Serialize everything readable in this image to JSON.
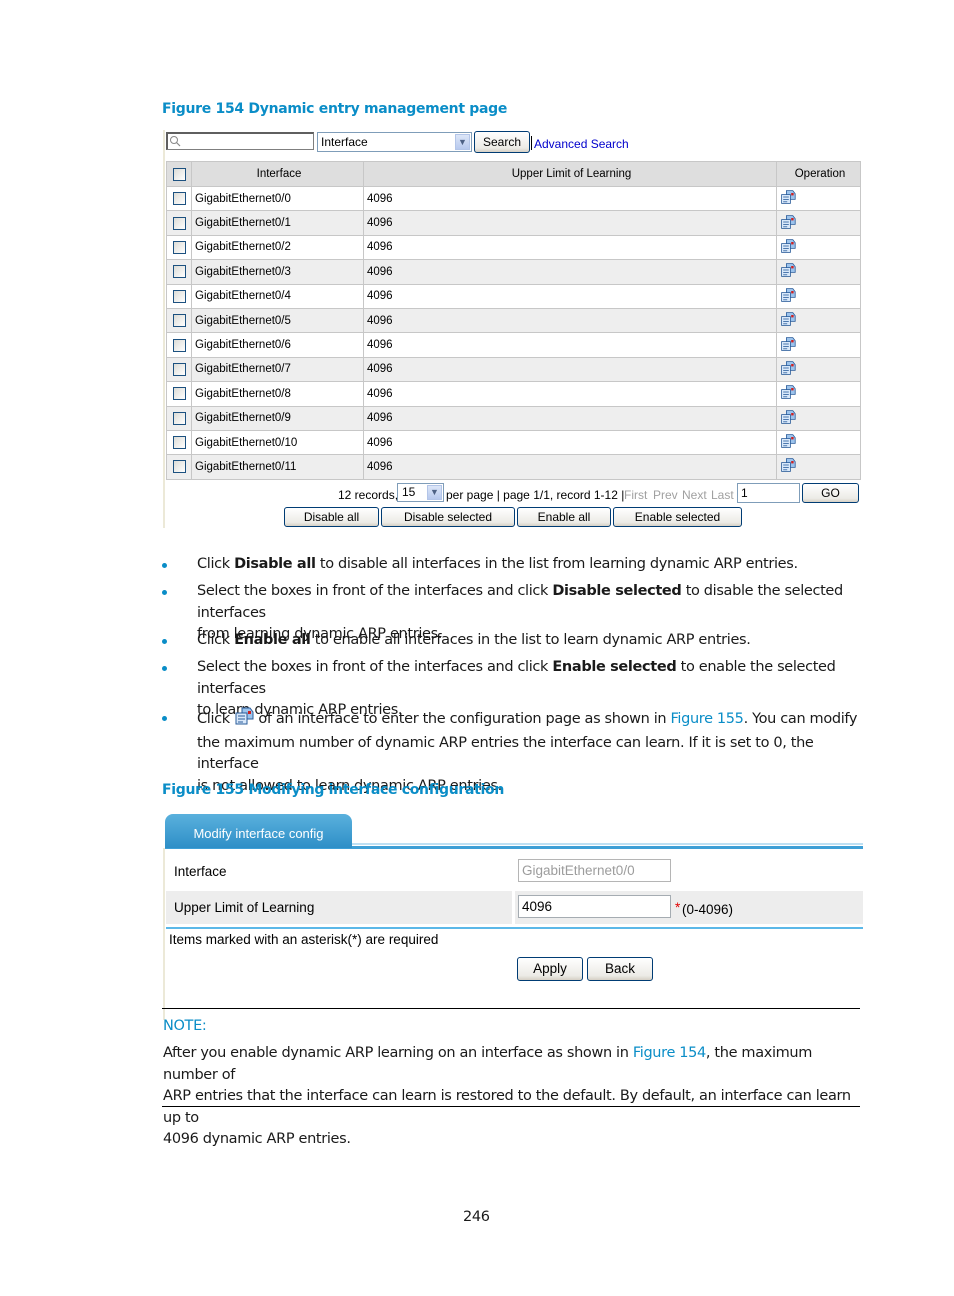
{
  "figure154": {
    "caption": "Figure 154 Dynamic entry management page",
    "search": {
      "placeholder": "",
      "field_select": "Interface",
      "search_button": "Search",
      "advanced_search": "Advanced Search"
    },
    "table": {
      "columns": [
        "Interface",
        "Upper Limit of Learning",
        "Operation"
      ],
      "rows": [
        {
          "interface": "GigabitEthernet0/0",
          "limit": "4096"
        },
        {
          "interface": "GigabitEthernet0/1",
          "limit": "4096"
        },
        {
          "interface": "GigabitEthernet0/2",
          "limit": "4096"
        },
        {
          "interface": "GigabitEthernet0/3",
          "limit": "4096"
        },
        {
          "interface": "GigabitEthernet0/4",
          "limit": "4096"
        },
        {
          "interface": "GigabitEthernet0/5",
          "limit": "4096"
        },
        {
          "interface": "GigabitEthernet0/6",
          "limit": "4096"
        },
        {
          "interface": "GigabitEthernet0/7",
          "limit": "4096"
        },
        {
          "interface": "GigabitEthernet0/8",
          "limit": "4096"
        },
        {
          "interface": "GigabitEthernet0/9",
          "limit": "4096"
        },
        {
          "interface": "GigabitEthernet0/10",
          "limit": "4096"
        },
        {
          "interface": "GigabitEthernet0/11",
          "limit": "4096"
        }
      ],
      "operation_icon": "edit-config-icon"
    },
    "pager": {
      "records": "12 records,",
      "per_page_value": "15",
      "per_page_text": "per page | page 1/1, record 1-12 |",
      "first": "First",
      "prev": "Prev",
      "next": "Next",
      "last": "Last",
      "page_input": "1",
      "go": "GO"
    },
    "actions": {
      "disable_all": "Disable all",
      "disable_selected": "Disable selected",
      "enable_all": "Enable all",
      "enable_selected": "Enable selected"
    }
  },
  "bullets": [
    {
      "pre": "Click ",
      "bold": "Disable all",
      "post": " to disable all interfaces in the list from learning dynamic ARP entries."
    },
    {
      "pre": "Select the boxes in front of the interfaces and click ",
      "bold": "Disable selected",
      "post": " to disable the selected interfaces",
      "line2": "from learning dynamic ARP entries."
    },
    {
      "pre": "Click ",
      "bold": "Enable all",
      "post": " to enable all interfaces in the list to learn dynamic ARP entries."
    },
    {
      "pre": "Select the boxes in front of the interfaces and click ",
      "bold": "Enable selected",
      "post": " to enable the selected interfaces",
      "line2": "to learn dynamic ARP entries."
    },
    {
      "pre": "Click ",
      "post": " of an interface to enter the configuration page as shown in ",
      "link": "Figure 155",
      "post2": ". You can modify",
      "line2": "the maximum number of dynamic ARP entries the interface can learn. If it is set to 0, the interface",
      "line3": "is not allowed to learn dynamic ARP entries."
    }
  ],
  "figure155": {
    "caption": "Figure 155 Modifying interface configuration",
    "tab": "Modify interface config",
    "fields": {
      "interface_label": "Interface",
      "interface_value": "GigabitEthernet0/0",
      "limit_label": "Upper Limit of Learning",
      "limit_value": "4096",
      "required_mark": "*",
      "limit_range": "(0-4096)"
    },
    "required_note": "Items marked with an asterisk(*) are required",
    "apply": "Apply",
    "back": "Back"
  },
  "note": {
    "title": "NOTE:",
    "line1_pre": "After you enable dynamic ARP learning on an interface as shown in ",
    "line1_link": "Figure 154",
    "line1_post": ", the maximum number of",
    "line2": "ARP entries that the interface can learn is restored to the default. By default, an interface can learn up to",
    "line3": "4096 dynamic ARP entries."
  },
  "page_number": "246",
  "colors": {
    "caption_blue": "#0A8DC7",
    "link_blue": "#0A8DC7",
    "tab_blue": "#3E9FD6",
    "required_red": "#E00000"
  }
}
